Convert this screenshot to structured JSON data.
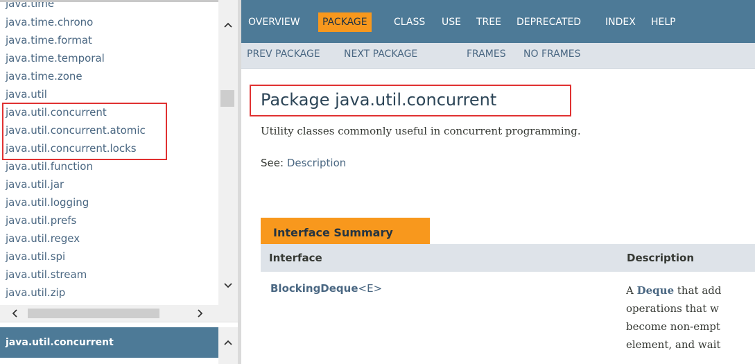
{
  "packages_frame": {
    "items": [
      "java.time",
      "java.time.chrono",
      "java.time.format",
      "java.time.temporal",
      "java.time.zone",
      "java.util",
      "java.util.concurrent",
      "java.util.concurrent.atomic",
      "java.util.concurrent.locks",
      "java.util.function",
      "java.util.jar",
      "java.util.logging",
      "java.util.prefs",
      "java.util.regex",
      "java.util.spi",
      "java.util.stream",
      "java.util.zip"
    ],
    "highlighted": [
      "java.util.concurrent",
      "java.util.concurrent.atomic",
      "java.util.concurrent.locks"
    ]
  },
  "classes_frame": {
    "header": "java.util.concurrent"
  },
  "icons": {
    "scroll_up": "chevron-up-icon",
    "scroll_down": "chevron-down-icon",
    "scroll_left": "chevron-left-icon",
    "scroll_right": "chevron-right-icon"
  },
  "topnav": {
    "items": [
      "OVERVIEW",
      "PACKAGE",
      "CLASS",
      "USE",
      "TREE",
      "DEPRECATED",
      "INDEX",
      "HELP"
    ],
    "active": "PACKAGE"
  },
  "subnav": {
    "prev_package": "PREV PACKAGE",
    "next_package": "NEXT PACKAGE",
    "frames": "FRAMES",
    "no_frames": "NO FRAMES"
  },
  "content": {
    "title": "Package java.util.concurrent",
    "description": "Utility classes commonly useful in concurrent programming.",
    "see_label": "See:",
    "see_link": "Description",
    "summary_caption": "Interface Summary",
    "columns": [
      "Interface",
      "Description"
    ],
    "rows": [
      {
        "name": "BlockingDeque",
        "type_param": "<E>",
        "description_link": "Deque",
        "description_lines": [
          "A",
          " that add",
          "operations that w",
          "become non-empt",
          "element, and wait"
        ]
      }
    ]
  },
  "colors": {
    "nav_bg": "#4D7A97",
    "nav_active": "#F8981D",
    "subnav_bg": "#DEE3E9",
    "link": "#4A6782",
    "highlight": "#e03131"
  }
}
